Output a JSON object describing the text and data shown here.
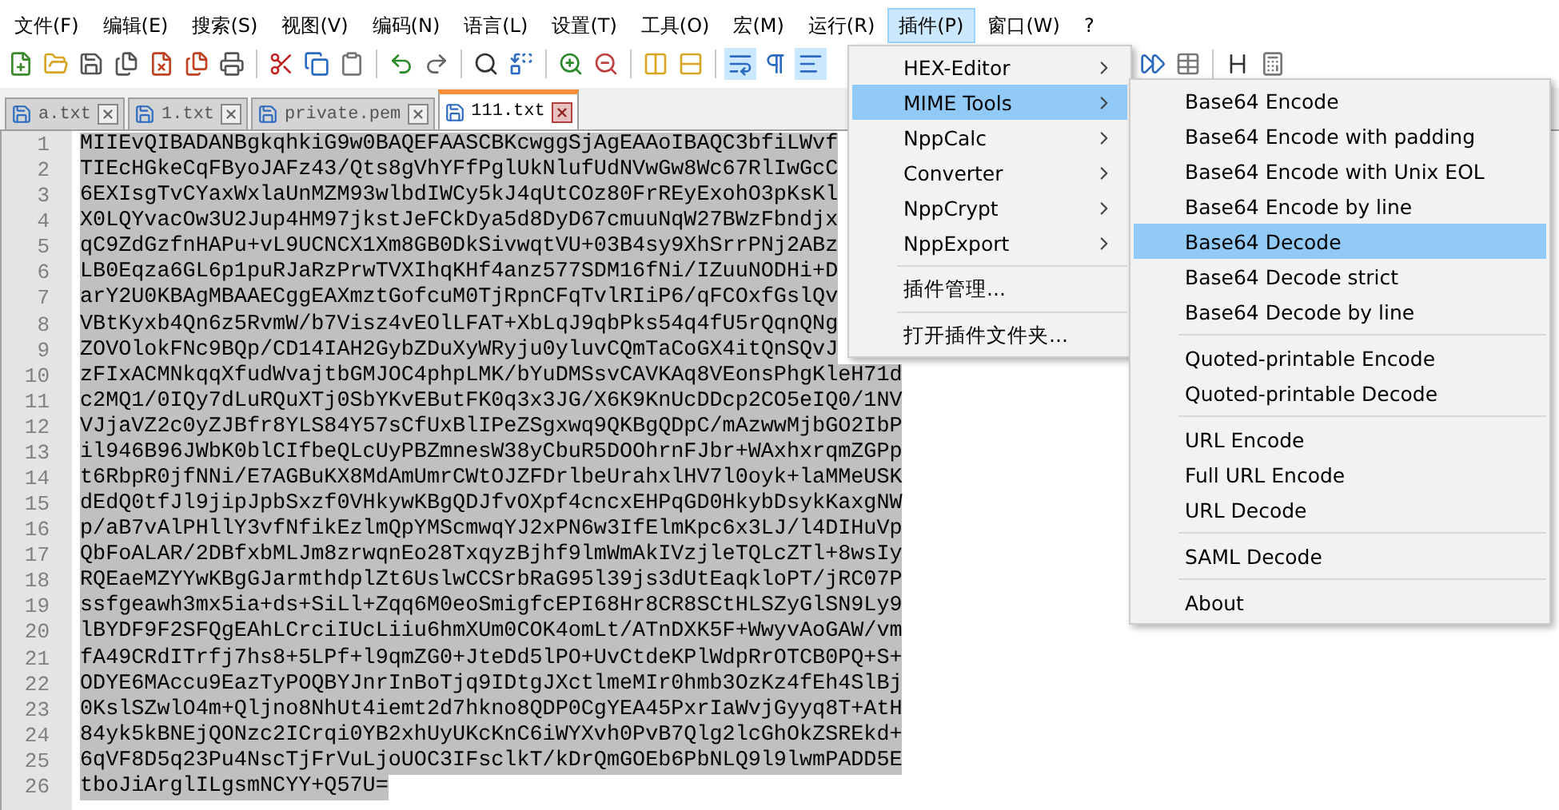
{
  "menu_bar": [
    {
      "label": "文件(F)",
      "selected": false
    },
    {
      "label": "编辑(E)",
      "selected": false
    },
    {
      "label": "搜索(S)",
      "selected": false
    },
    {
      "label": "视图(V)",
      "selected": false
    },
    {
      "label": "编码(N)",
      "selected": false
    },
    {
      "label": "语言(L)",
      "selected": false
    },
    {
      "label": "设置(T)",
      "selected": false
    },
    {
      "label": "工具(O)",
      "selected": false
    },
    {
      "label": "宏(M)",
      "selected": false
    },
    {
      "label": "运行(R)",
      "selected": false
    },
    {
      "label": "插件(P)",
      "selected": true
    },
    {
      "label": "窗口(W)",
      "selected": false
    },
    {
      "label": "?",
      "selected": false
    }
  ],
  "tabs": [
    {
      "label": "a.txt",
      "selected": false
    },
    {
      "label": "1.txt",
      "selected": false
    },
    {
      "label": "private.pem",
      "selected": false
    },
    {
      "label": "111.txt",
      "selected": true
    }
  ],
  "editor": {
    "lines": [
      {
        "number": "1",
        "text": "MIIEvQIBADANBgkqhkiG9w0BAQEFAASCBKcwggSjAgEAAoIBAQC3bfiLWvf",
        "selected": true
      },
      {
        "number": "2",
        "text": "TIEcHGkeCqFByoJAFz43/Qts8gVhYFfPglUkNlufUdNVwGw8Wc67RlIwGcC",
        "selected": true
      },
      {
        "number": "3",
        "text": "6EXIsgTvCYaxWxlaUnMZM93wlbdIWCy5kJ4qUtCOz80FrREyExohO3pKsKl",
        "selected": true
      },
      {
        "number": "4",
        "text": "X0LQYvacOw3U2Jup4HM97jkstJeFCkDya5d8DyD67cmuuNqW27BWzFbndjx",
        "selected": true
      },
      {
        "number": "5",
        "text": "qC9ZdGzfnHAPu+vL9UCNCX1Xm8GB0DkSivwqtVU+03B4sy9XhSrrPNj2ABz",
        "selected": true
      },
      {
        "number": "6",
        "text": "LB0Eqza6GL6p1puRJaRzPrwTVXIhqKHf4anz577SDM16fNi/IZuuNODHi+D",
        "selected": true
      },
      {
        "number": "7",
        "text": "arY2U0KBAgMBAAECggEAXmztGofcuM0TjRpnCFqTvlRIiP6/qFCOxfGslQv",
        "selected": true
      },
      {
        "number": "8",
        "text": "VBtKyxb4Qn6z5RvmW/b7Visz4vEOlLFAT+XbLqJ9qbPks54q4fU5rQqnQNg",
        "selected": true
      },
      {
        "number": "9",
        "text": "ZOVOlokFNc9BQp/CD14IAH2GybZDuXyWRyju0yluvCQmTaCoGX4itQnSQvJ",
        "selected": true
      },
      {
        "number": "10",
        "text": "zFIxACMNkqqXfudWvajtbGMJOC4phpLMK/bYuDMSsvCAVKAq8VEonsPhgKleH71d",
        "selected": true
      },
      {
        "number": "11",
        "text": "c2MQ1/0IQy7dLuRQuXTj0SbYKvEButFK0q3x3JG/X6K9KnUcDDcp2CO5eIQ0/1NV",
        "selected": true
      },
      {
        "number": "12",
        "text": "VJjaVZ2c0yZJBfr8YLS84Y57sCfUxBlIPeZSgxwq9QKBgQDpC/mAzwwMjbGO2IbP",
        "selected": true
      },
      {
        "number": "13",
        "text": "il946B96JWbK0blCIfbeQLcUyPBZmnesW38yCbuR5DOOhrnFJbr+WAxhxrqmZGPp",
        "selected": true
      },
      {
        "number": "14",
        "text": "t6RbpR0jfNNi/E7AGBuKX8MdAmUmrCWtOJZFDrlbeUrahxlHV7l0oyk+laMMeUSK",
        "selected": true
      },
      {
        "number": "15",
        "text": "dEdQ0tfJl9jipJpbSxzf0VHkywKBgQDJfvOXpf4cncxEHPqGD0HkybDsykKaxgNW",
        "selected": true
      },
      {
        "number": "16",
        "text": "p/aB7vAlPHllY3vfNfikEzlmQpYMScmwqYJ2xPN6w3IfElmKpc6x3LJ/l4DIHuVp",
        "selected": true
      },
      {
        "number": "17",
        "text": "QbFoALAR/2DBfxbMLJm8zrwqnEo28TxqyzBjhf9lmWmAkIVzjleTQLcZTl+8wsIy",
        "selected": true
      },
      {
        "number": "18",
        "text": "RQEaeMZYYwKBgGJarmthdplZt6UslwCCSrbRaG95l39js3dUtEaqkloPT/jRC07P",
        "selected": true
      },
      {
        "number": "19",
        "text": "ssfgeawh3mx5ia+ds+SiLl+Zqq6M0eoSmigfcEPI68Hr8CR8SCtHLSZyGlSN9Ly9",
        "selected": true
      },
      {
        "number": "20",
        "text": "lBYDF9F2SFQgEAhLCrciIUcLiiu6hmXUm0COK4omLt/ATnDXK5F+WwyvAoGAW/vm",
        "selected": true
      },
      {
        "number": "21",
        "text": "fA49CRdITrfj7hs8+5LPf+l9qmZG0+JteDd5lPO+UvCtdeKPlWdpRrOTCB0PQ+S+",
        "selected": true
      },
      {
        "number": "22",
        "text": "ODYE6MAccu9EazTyPOQBYJnrInBoTjq9IDtgJXctlmeMIr0hmb3OzKz4fEh4SlBj",
        "selected": true
      },
      {
        "number": "23",
        "text": "0KslSZwlO4m+Qljno8NhUt4iemt2d7hkno8QDP0CgYEA45PxrIaWvjGyyq8T+AtH",
        "selected": true
      },
      {
        "number": "24",
        "text": "84yk5kBNEjQONzc2ICrqi0YB2xhUyUKcKnC6iWYXvh0PvB7Qlg2lcGhOkZSREkd+",
        "selected": true
      },
      {
        "number": "25",
        "text": "6qVF8D5q23Pu4NscTjFrVuLjoUOC3IFsclkT/kDrQmGOEb6PbNLQ9l9lwmPADD5E",
        "selected": true
      },
      {
        "number": "26",
        "text": "tboJiArglILgsmNCYY+Q57U=",
        "selected": true
      }
    ]
  },
  "plugins_menu": {
    "items": [
      {
        "kind": "item",
        "label": "HEX-Editor",
        "submenu": true,
        "highlighted": false
      },
      {
        "kind": "item",
        "label": "MIME Tools",
        "submenu": true,
        "highlighted": true
      },
      {
        "kind": "item",
        "label": "NppCalc",
        "submenu": true,
        "highlighted": false
      },
      {
        "kind": "item",
        "label": "Converter",
        "submenu": true,
        "highlighted": false
      },
      {
        "kind": "item",
        "label": "NppCrypt",
        "submenu": true,
        "highlighted": false
      },
      {
        "kind": "item",
        "label": "NppExport",
        "submenu": true,
        "highlighted": false
      },
      {
        "kind": "separator"
      },
      {
        "kind": "item",
        "label": "插件管理...",
        "submenu": false,
        "highlighted": false
      },
      {
        "kind": "separator"
      },
      {
        "kind": "item",
        "label": "打开插件文件夹...",
        "submenu": false,
        "highlighted": false
      }
    ]
  },
  "mime_tools_submenu": {
    "items": [
      {
        "kind": "item",
        "label": "Base64 Encode",
        "highlighted": false
      },
      {
        "kind": "item",
        "label": "Base64 Encode with padding",
        "highlighted": false
      },
      {
        "kind": "item",
        "label": "Base64 Encode with Unix EOL",
        "highlighted": false
      },
      {
        "kind": "item",
        "label": "Base64 Encode by line",
        "highlighted": false
      },
      {
        "kind": "item",
        "label": "Base64 Decode",
        "highlighted": true
      },
      {
        "kind": "item",
        "label": "Base64 Decode strict",
        "highlighted": false
      },
      {
        "kind": "item",
        "label": "Base64 Decode by line",
        "highlighted": false
      },
      {
        "kind": "separator"
      },
      {
        "kind": "item",
        "label": "Quoted-printable Encode",
        "highlighted": false
      },
      {
        "kind": "item",
        "label": "Quoted-printable Decode",
        "highlighted": false
      },
      {
        "kind": "separator"
      },
      {
        "kind": "item",
        "label": "URL Encode",
        "highlighted": false
      },
      {
        "kind": "item",
        "label": "Full URL Encode",
        "highlighted": false
      },
      {
        "kind": "item",
        "label": "URL Decode",
        "highlighted": false
      },
      {
        "kind": "separator"
      },
      {
        "kind": "item",
        "label": "SAML Decode",
        "highlighted": false
      },
      {
        "kind": "separator"
      },
      {
        "kind": "item",
        "label": "About",
        "highlighted": false
      }
    ]
  }
}
